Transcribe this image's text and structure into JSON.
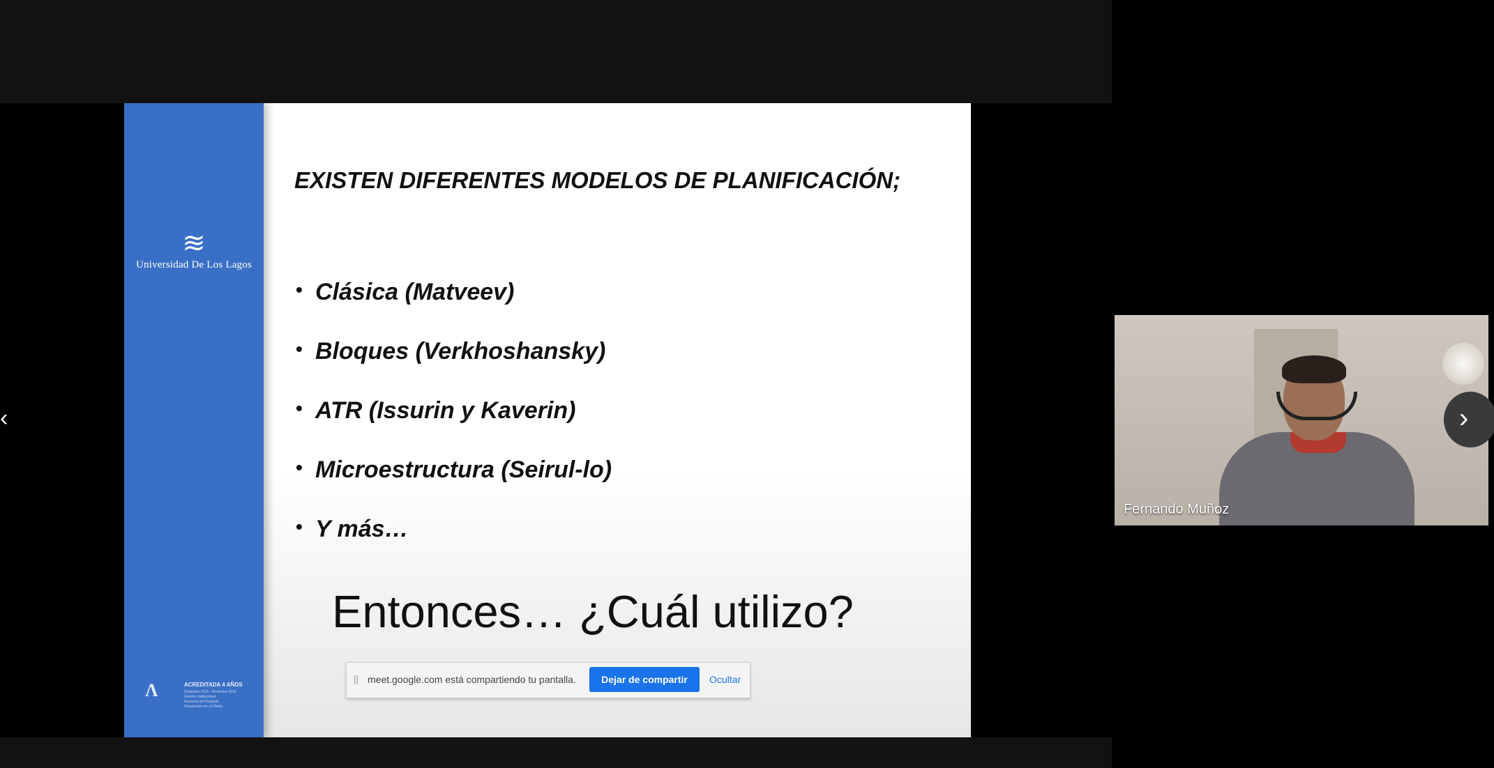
{
  "slide": {
    "title": "EXISTEN DIFERENTES MODELOS DE PLANIFICACIÓN;",
    "bullets": [
      "Clásica (Matveev)",
      "Bloques (Verkhoshansky)",
      "ATR (Issurin y Kaverin)",
      "Microestructura (Seirul-lo)",
      "Y más…"
    ],
    "question": "Entonces… ¿Cuál utilizo?",
    "university_name": "Universidad De Los Lagos",
    "accreditation": {
      "title": "ACREDITADA 4 AÑOS",
      "details": "Diciembre 2015 - Diciembre 2019\nGestión Institucional\nDocencia de Pregrado\nVinculación con el Medio"
    }
  },
  "share_bar": {
    "drag_handle": "||",
    "message": "meet.google.com está compartiendo tu pantalla.",
    "stop_label": "Dejar de compartir",
    "hide_label": "Ocultar"
  },
  "participant": {
    "name": "Fernando Muñoz"
  },
  "navigation": {
    "prev_icon": "‹",
    "next_icon": "›"
  },
  "colors": {
    "sidebar": "#3a6fc6",
    "stop_button": "#1a73e8",
    "frame": "#121212"
  }
}
